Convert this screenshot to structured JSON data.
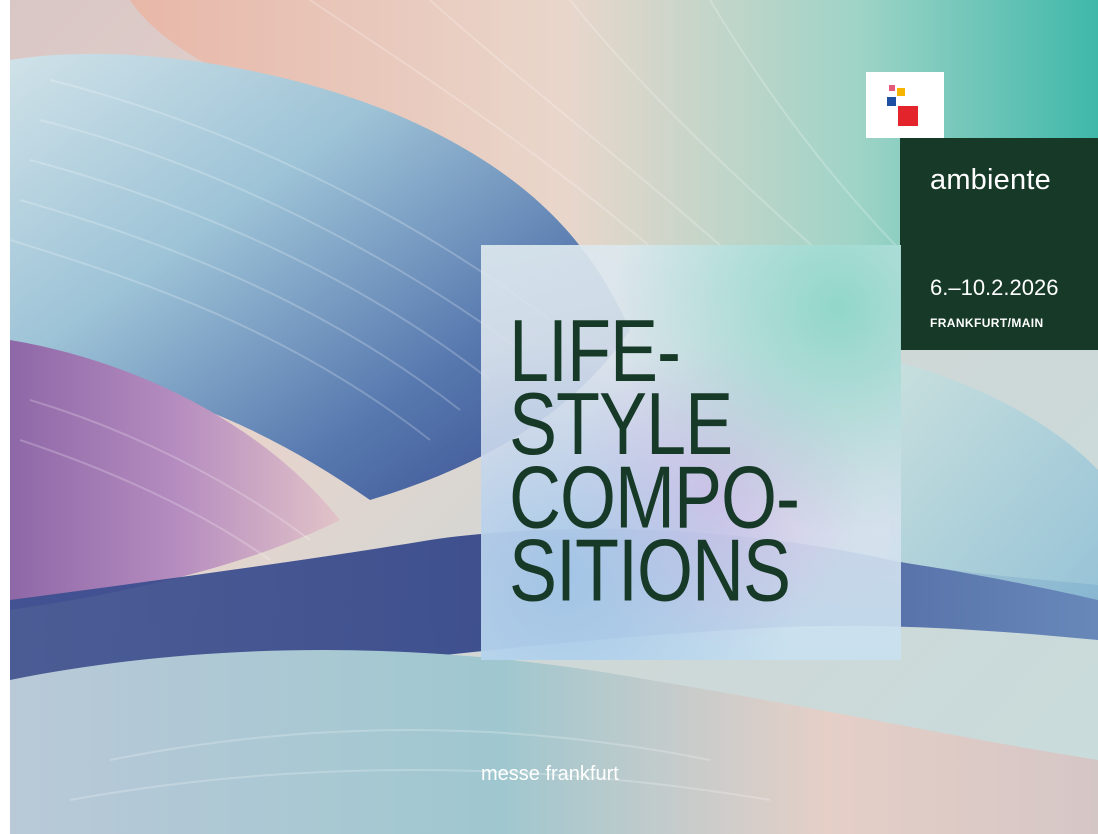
{
  "headline": {
    "lines": [
      "LIFE-",
      "STYLE",
      "COMPO-",
      "SITIONS"
    ]
  },
  "event": {
    "brand": "ambiente",
    "dates": "6.–10.2.2026",
    "city": "FRANKFURT/MAIN"
  },
  "footer": {
    "organizer": "messe frankfurt"
  },
  "colors": {
    "panel_green": "#173a28",
    "logo_red": "#e3242b",
    "logo_blue": "#1f4fa3",
    "logo_yellow": "#f5b400",
    "logo_pink": "#e55a7a"
  },
  "icons": {
    "logo": "messe-frankfurt-logo-icon"
  }
}
